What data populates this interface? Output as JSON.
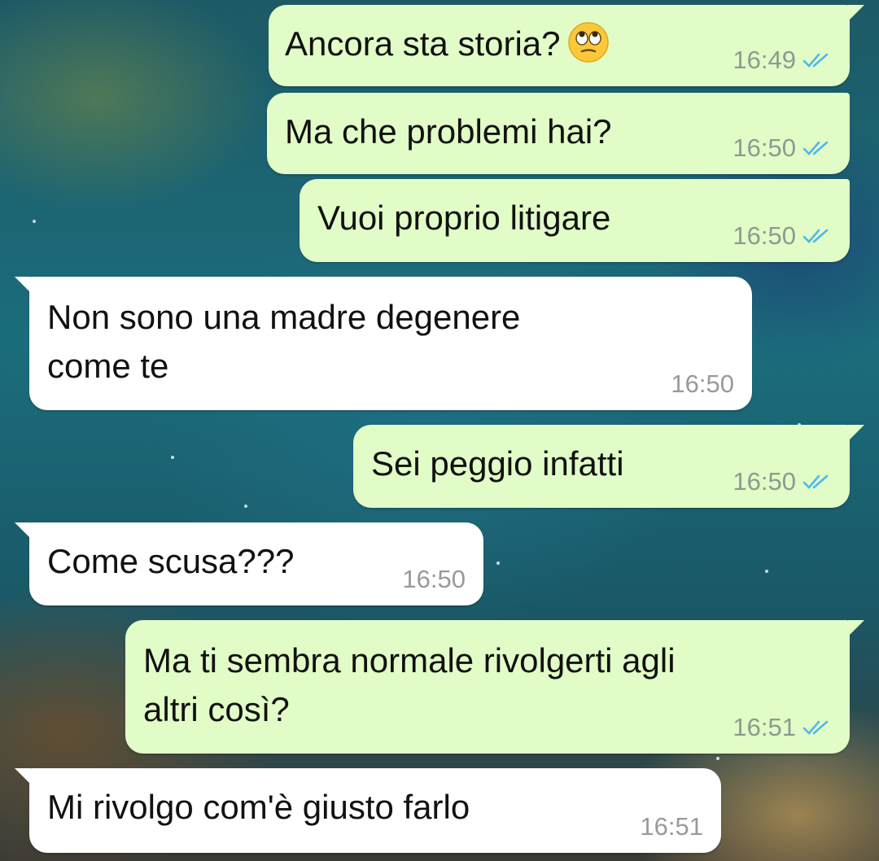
{
  "messages": [
    {
      "direction": "out",
      "text": "Ancora sta storia?",
      "emoji": "face-with-rolling-eyes",
      "time": "16:49",
      "status": "read"
    },
    {
      "direction": "out",
      "text": "Ma che problemi hai?",
      "time": "16:50",
      "status": "read"
    },
    {
      "direction": "out",
      "text": "Vuoi proprio litigare",
      "time": "16:50",
      "status": "read"
    },
    {
      "direction": "in",
      "text": "Non sono una madre degenere\ncome te",
      "time": "16:50"
    },
    {
      "direction": "out",
      "text": "Sei peggio infatti",
      "time": "16:50",
      "status": "read"
    },
    {
      "direction": "in",
      "text": "Come scusa???",
      "time": "16:50"
    },
    {
      "direction": "out",
      "text": "Ma ti sembra normale rivolgerti agli\naltri così?",
      "time": "16:51",
      "status": "read"
    },
    {
      "direction": "in",
      "text": "Mi rivolgo com'è giusto farlo",
      "time": "16:51"
    }
  ],
  "colors": {
    "outgoing_bubble": "#e1fcc6",
    "incoming_bubble": "#ffffff",
    "read_ticks": "#4fb6ec",
    "timestamp": "#8c9a92"
  }
}
